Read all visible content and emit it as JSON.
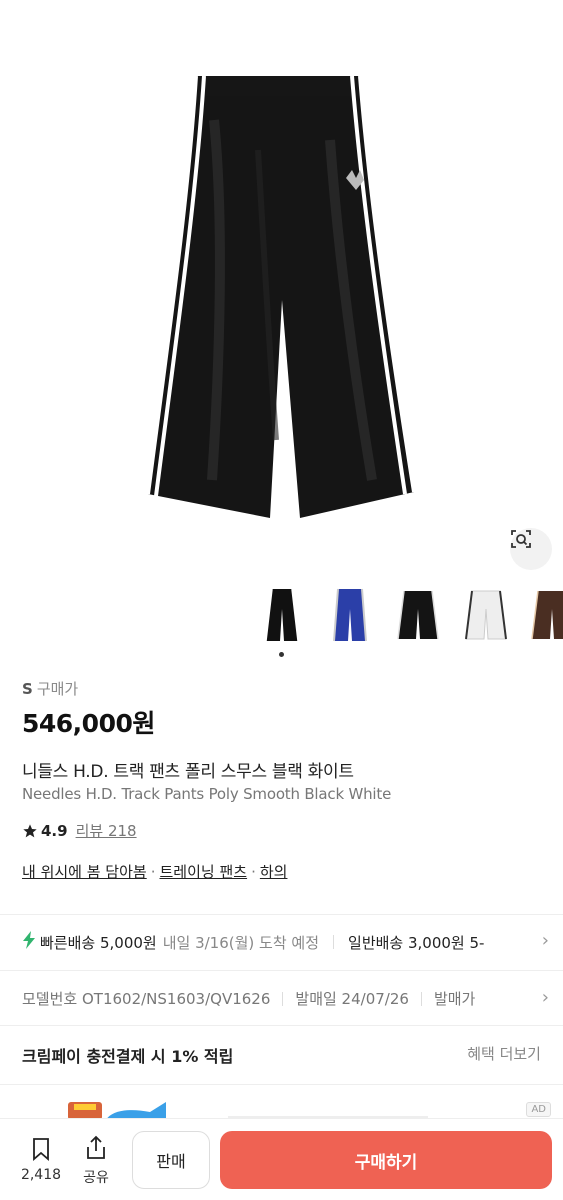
{
  "product": {
    "size_label": "S",
    "price_type": "구매가",
    "price": "546,000원",
    "name_ko": "니들스 H.D. 트랙 팬츠 폴리 스무스 블랙 화이트",
    "name_en": "Needles H.D. Track Pants Poly Smooth Black White",
    "rating": "4.9",
    "review": "리뷰 218",
    "categories": [
      "내 위시에 봄 담아봄",
      "트레이닝 팬츠",
      "하의"
    ],
    "category_sep": "·"
  },
  "thumbnails": [
    {
      "name": "black-white",
      "color": "#111111",
      "stripe": "#ffffff"
    },
    {
      "name": "blue",
      "color": "#2b3fa8",
      "stripe": "#cccccc"
    },
    {
      "name": "black-wide",
      "color": "#141414",
      "stripe": "#dddddd"
    },
    {
      "name": "white",
      "color": "#eeeeee",
      "stripe": "#333333"
    },
    {
      "name": "brown",
      "color": "#4a2e22",
      "stripe": "#e6c9a8"
    }
  ],
  "shipping": {
    "fast_label": "빠른배송 5,000원",
    "fast_eta": "내일 3/16(월) 도착 예정",
    "normal_label": "일반배송 3,000원 5-"
  },
  "model_info": {
    "model": "모델번호 OT1602/NS1603/QV1626",
    "release": "발매일 24/07/26",
    "release_price": "발매가"
  },
  "cream_pay": {
    "text": "크림페이 충전결제 시 1% 적립",
    "more": "혜택 더보기"
  },
  "ad": {
    "badge": "AD"
  },
  "bottom": {
    "bookmark_count": "2,418",
    "share_label": "공유",
    "sell_label": "판매",
    "buy_label": "구매하기"
  },
  "colors": {
    "accent": "#ef6253",
    "fast": "#31b46e"
  }
}
